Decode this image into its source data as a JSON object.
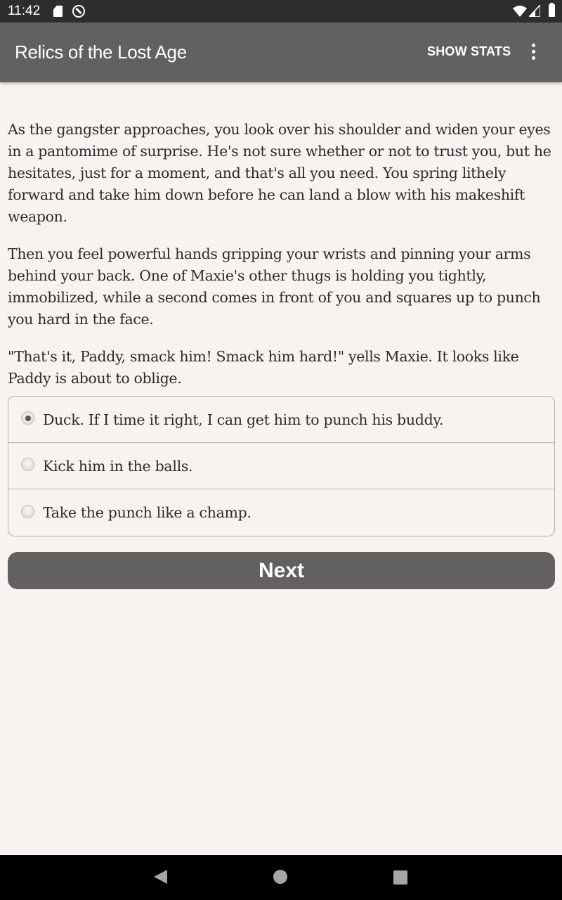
{
  "status_bar": {
    "time": "11:42",
    "icons": [
      "sd-card-icon",
      "sync-disabled-icon",
      "wifi-icon",
      "cell-signal-icon",
      "battery-icon"
    ]
  },
  "app_bar": {
    "title": "Relics of the Lost Age",
    "show_stats_label": "SHOW STATS",
    "overflow_icon": "more-vert-icon"
  },
  "story": {
    "paragraphs": [
      "As the gangster approaches, you look over his shoulder and widen your eyes in a pantomime of surprise. He's not sure whether or not to trust you, but he hesitates, just for a moment, and that's all you need. You spring lithely forward and take him down before he can land a blow with his makeshift weapon.",
      "Then you feel powerful hands gripping your wrists and pinning your arms behind your back. One of Maxie's other thugs is holding you tightly, immobilized, while a second comes in front of you and squares up to punch you hard in the face.",
      "\"That's it, Paddy, smack him! Smack him hard!\" yells Maxie. It looks like Paddy is about to oblige."
    ]
  },
  "choices": {
    "selected_index": 0,
    "options": [
      {
        "label": "Duck. If I time it right, I can get him to punch his buddy.",
        "checked": true
      },
      {
        "label": "Kick him in the balls.",
        "checked": false
      },
      {
        "label": "Take the punch like a champ.",
        "checked": false
      }
    ]
  },
  "next_button": {
    "label": "Next"
  },
  "nav_bar": {
    "icons": [
      "back-icon",
      "home-icon",
      "recents-icon"
    ]
  }
}
